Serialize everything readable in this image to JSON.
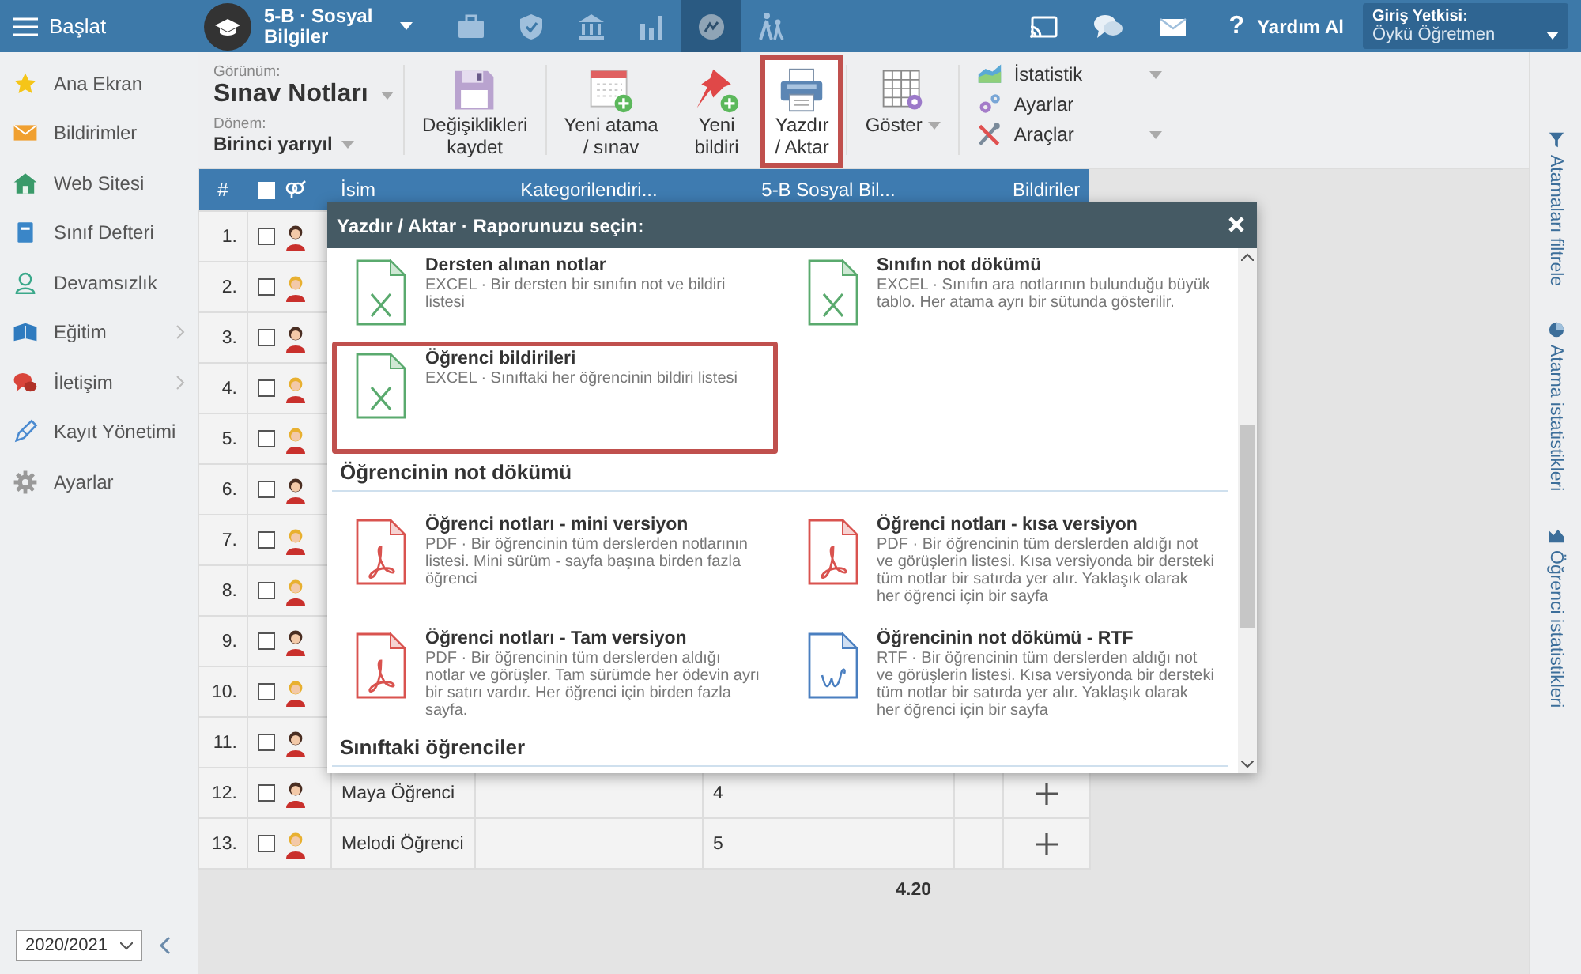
{
  "topbar": {
    "menu_label": "Başlat",
    "class_title": "5-B · Sosyal Bilgiler",
    "nav": [
      {
        "selected": false
      },
      {
        "selected": false
      },
      {
        "selected": false
      },
      {
        "selected": false
      },
      {
        "selected": true
      },
      {
        "selected": false
      }
    ],
    "help_mark": "?",
    "help_label": "Yardım Al",
    "login_label": "Giriş Yetkisi:",
    "login_user": "Öykü Öğretmen"
  },
  "sidebar": {
    "items": [
      {
        "label": "Ana Ekran",
        "has_submenu": false
      },
      {
        "label": "Bildirimler",
        "has_submenu": false
      },
      {
        "label": "Web Sitesi",
        "has_submenu": false
      },
      {
        "label": "Sınıf Defteri",
        "has_submenu": false
      },
      {
        "label": "Devamsızlık",
        "has_submenu": false
      },
      {
        "label": "Eğitim",
        "has_submenu": true
      },
      {
        "label": "İletişim",
        "has_submenu": true
      },
      {
        "label": "Kayıt Yönetimi",
        "has_submenu": false
      },
      {
        "label": "Ayarlar",
        "has_submenu": false
      }
    ],
    "year": "2020/2021"
  },
  "toolbar": {
    "view_label": "Görünüm:",
    "view_value": "Sınav Notları",
    "term_label": "Dönem:",
    "term_value": "Birinci yarıyıl",
    "buttons": [
      {
        "label": "Değişiklikleri\nkaydet",
        "selected": false,
        "dropdown": false
      },
      {
        "label": "Yeni atama\n/ sınav",
        "selected": false,
        "dropdown": false
      },
      {
        "label": "Yeni\nbildiri",
        "selected": false,
        "dropdown": false
      },
      {
        "label": "Yazdır\n/ Aktar",
        "selected": true,
        "dropdown": false
      },
      {
        "label": "Göster",
        "selected": false,
        "dropdown": true
      }
    ],
    "menu": [
      {
        "label": "İstatistik",
        "dropdown": true
      },
      {
        "label": "Ayarlar",
        "dropdown": false
      },
      {
        "label": "Araçlar",
        "dropdown": true
      }
    ]
  },
  "table": {
    "header": {
      "number": "#",
      "select_all_checked": false,
      "name": "İsim",
      "category": "Kategorilendiri...",
      "grade": "5-B Sosyal Bil...",
      "notes": "Bildiriler"
    },
    "rows": [
      {
        "number": "1.",
        "checked": false,
        "kind": "boy"
      },
      {
        "number": "2.",
        "checked": false,
        "kind": "girl"
      },
      {
        "number": "3.",
        "checked": false,
        "kind": "boy"
      },
      {
        "number": "4.",
        "checked": false,
        "kind": "girl"
      },
      {
        "number": "5.",
        "checked": false,
        "kind": "girl"
      },
      {
        "number": "6.",
        "checked": false,
        "kind": "boy"
      },
      {
        "number": "7.",
        "checked": false,
        "kind": "girl"
      },
      {
        "number": "8.",
        "checked": false,
        "kind": "girl"
      },
      {
        "number": "9.",
        "checked": false,
        "kind": "boy"
      },
      {
        "number": "10.",
        "checked": false,
        "kind": "girl"
      },
      {
        "number": "11.",
        "checked": false,
        "kind": "boy"
      },
      {
        "number": "12.",
        "checked": false,
        "kind": "boy",
        "name": "Maya Öğrenci",
        "grade": "4"
      },
      {
        "number": "13.",
        "checked": false,
        "kind": "girl",
        "name": "Melodi Öğrenci",
        "grade": "5"
      }
    ],
    "average": "4.20"
  },
  "dialog": {
    "title": "Yazdır / Aktar · Raporunuzu seçin:",
    "sections": [
      {
        "items": [
          {
            "kind": "excel",
            "selected": false,
            "title": "Dersten alınan notlar",
            "description": "EXCEL · Bir dersten bir sınıfın not ve bildiri listesi"
          },
          {
            "kind": "excel",
            "selected": false,
            "title": "Sınıfın not dökümü",
            "description": "EXCEL · Sınıfın ara notlarının bulunduğu büyük tablo. Her atama ayrı bir sütunda gösterilir."
          },
          {
            "kind": "excel",
            "selected": true,
            "title": "Öğrenci bildirileri",
            "description": "EXCEL · Sınıftaki her öğrencinin bildiri listesi"
          }
        ]
      },
      {
        "heading": "Öğrencinin not dökümü",
        "items": [
          {
            "kind": "pdf",
            "selected": false,
            "title": "Öğrenci notları - mini versiyon",
            "description": "PDF · Bir öğrencinin tüm derslerden notlarının listesi. Mini sürüm - sayfa başına birden fazla öğrenci"
          },
          {
            "kind": "pdf",
            "selected": false,
            "title": "Öğrenci notları - kısa versiyon",
            "description": "PDF · Bir öğrencinin tüm derslerden aldığı not ve görüşlerin listesi. Kısa versiyonda bir dersteki tüm notlar bir satırda yer alır. Yaklaşık olarak her öğrenci için bir sayfa"
          },
          {
            "kind": "pdf",
            "selected": false,
            "title": "Öğrenci notları - Tam versiyon",
            "description": "PDF · Bir öğrencinin tüm derslerden aldığı notlar ve görüşler. Tam sürümde her ödevin ayrı bir satırı vardır. Her öğrenci için birden fazla sayfa."
          },
          {
            "kind": "rtf",
            "selected": false,
            "title": "Öğrencinin not dökümü - RTF",
            "description": "RTF · Bir öğrencinin tüm derslerden aldığı not ve görüşlerin listesi. Kısa versiyonda bir dersteki tüm notlar bir satırda yer alır. Yaklaşık olarak her öğrenci için bir sayfa"
          }
        ]
      },
      {
        "heading": "Sınıftaki öğrenciler"
      }
    ]
  },
  "right_rail": [
    {
      "label": "Atamaları filtrele"
    },
    {
      "label": "Atama istatistikleri"
    },
    {
      "label": "Öğrenci istatistikleri"
    }
  ]
}
